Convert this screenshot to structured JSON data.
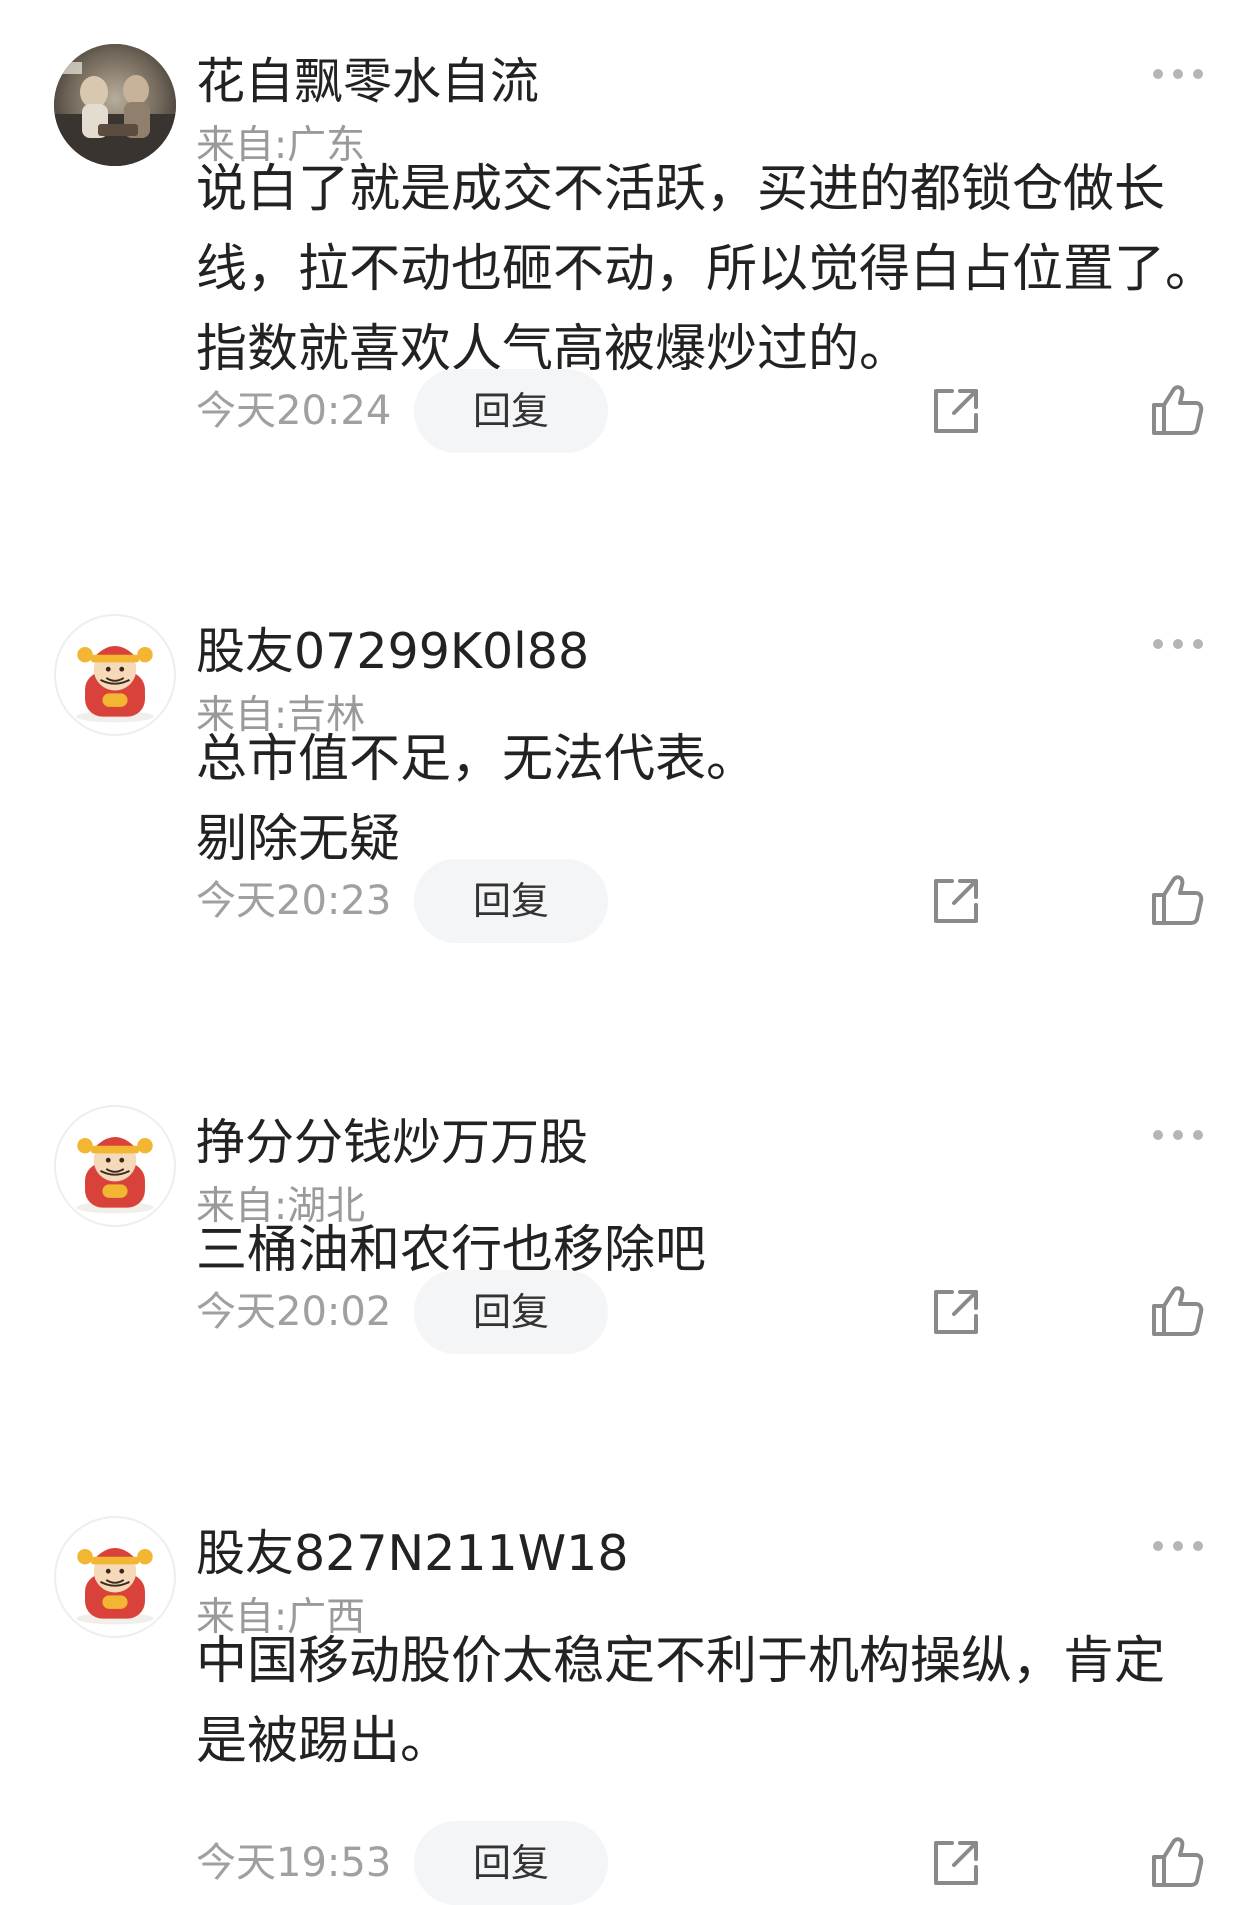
{
  "comments": [
    {
      "username": "花自飘零水自流",
      "location": "来自:广东",
      "avatar_type": "photo",
      "lines": [
        "说白了就是成交不活跃，买进的都锁仓做长",
        "线，拉不动也砸不动，所以觉得白占位置了。",
        "指数就喜欢人气高被爆炒过的。"
      ],
      "time": "今天20:24",
      "reply_label": "回复"
    },
    {
      "username": "股友07299K0l88",
      "location": "来自:吉林",
      "avatar_type": "caishen-cartoon",
      "lines": [
        "总市值不足，无法代表。",
        "剔除无疑"
      ],
      "time": "今天20:23",
      "reply_label": "回复"
    },
    {
      "username": "挣分分钱炒万万股",
      "location": "来自:湖北",
      "avatar_type": "caishen-cartoon",
      "lines": [
        "三桶油和农行也移除吧"
      ],
      "time": "今天20:02",
      "reply_label": "回复"
    },
    {
      "username": "股友827N211W18",
      "location": "来自:广西",
      "avatar_type": "caishen-cartoon",
      "lines": [
        "中国移动股价太稳定不利于机构操纵，肯定",
        "是被踢出。"
      ],
      "time": "今天19:53",
      "reply_label": "回复"
    }
  ],
  "icons": {
    "more": "more-dots-icon",
    "share": "share-icon",
    "like": "thumbs-up-icon"
  },
  "colors": {
    "username": "#222222",
    "meta": "#9a9a9a",
    "reply_bg": "#f4f5f7",
    "icon": "#8a8a8a"
  }
}
